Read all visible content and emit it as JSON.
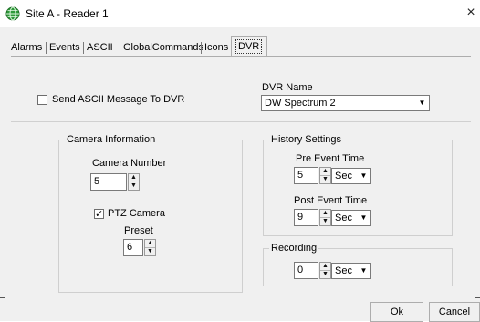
{
  "window": {
    "title": "Site A - Reader 1",
    "close_glyph": "×",
    "app_icon": "globe-icon"
  },
  "tabs": [
    {
      "label": "Alarms"
    },
    {
      "label": "Events"
    },
    {
      "label": "ASCII"
    },
    {
      "label": "GlobalCommands"
    },
    {
      "label": "Icons"
    },
    {
      "label": "DVR",
      "selected": true
    }
  ],
  "dvr": {
    "send_ascii_label": "Send ASCII Message To DVR",
    "send_ascii_checked": false,
    "dvr_name_label": "DVR Name",
    "dvr_name_value": "DW Spectrum 2"
  },
  "camera_info": {
    "title": "Camera Information",
    "camera_number_label": "Camera Number",
    "camera_number_value": "5",
    "ptz_label": "PTZ Camera",
    "ptz_checked": true,
    "preset_label": "Preset",
    "preset_value": "6"
  },
  "history": {
    "title": "History Settings",
    "pre_event_label": "Pre Event Time",
    "pre_event_value": "5",
    "pre_event_unit": "Sec",
    "post_event_label": "Post Event Time",
    "post_event_value": "9",
    "post_event_unit": "Sec"
  },
  "recording": {
    "title": "Recording",
    "value": "0",
    "unit": "Sec"
  },
  "buttons": {
    "ok": "Ok",
    "cancel": "Cancel"
  },
  "glyphs": {
    "check": "✓",
    "spin_up": "▲",
    "spin_down": "▼",
    "dropdown": "▼"
  },
  "colors": {
    "dialog_bg": "#f0f0f0",
    "titlebar_bg": "#ffffff",
    "border": "#7a7a7a"
  }
}
